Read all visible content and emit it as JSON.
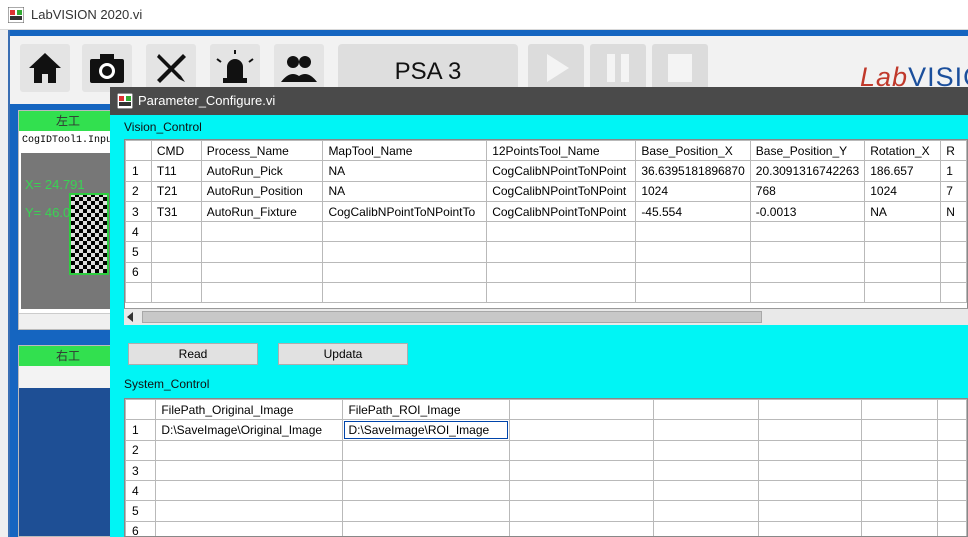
{
  "main_window": {
    "title": "LabVISION 2020.vi",
    "toolbar": {
      "icons": [
        "home-icon",
        "camera-icon",
        "tools-icon",
        "alarm-icon",
        "users-icon"
      ],
      "station_label": "PSA 3",
      "media_icons": [
        "play-icon",
        "pause-icon",
        "stop-icon"
      ],
      "logo_lab": "Lab",
      "logo_vision": "VISION"
    },
    "left_pane_1": {
      "title": "左工",
      "tool_label": "CogIDTool1.Inpu",
      "x_coord": "X= 24.791",
      "y_coord": "Y= 46.0"
    },
    "left_pane_2": {
      "title": "右工"
    }
  },
  "dialog": {
    "title": "Parameter_Configure.vi",
    "vision_control": {
      "label": "Vision_Control",
      "columns": [
        "",
        "CMD",
        "Process_Name",
        "MapTool_Name",
        "12PointsTool_Name",
        "Base_Position_X",
        "Base_Position_Y",
        "Rotation_X",
        "R"
      ],
      "rows": [
        [
          "1",
          "T11",
          "AutoRun_Pick",
          "NA",
          "CogCalibNPointToNPoint",
          "36.6395181896870",
          "20.3091316742263",
          "186.657",
          "1"
        ],
        [
          "2",
          "T21",
          "AutoRun_Position",
          "NA",
          "CogCalibNPointToNPoint",
          "1024",
          "768",
          "1024",
          "7"
        ],
        [
          "3",
          "T31",
          "AutoRun_Fixture",
          "CogCalibNPointToNPointTo",
          "CogCalibNPointToNPoint",
          "-45.554",
          "-0.0013",
          "NA",
          "N"
        ],
        [
          "4",
          "",
          "",
          "",
          "",
          "",
          "",
          "",
          ""
        ],
        [
          "5",
          "",
          "",
          "",
          "",
          "",
          "",
          "",
          ""
        ],
        [
          "6",
          "",
          "",
          "",
          "",
          "",
          "",
          "",
          ""
        ],
        [
          "",
          "",
          "",
          "",
          "",
          "",
          "",
          "",
          ""
        ]
      ]
    },
    "buttons": {
      "read": "Read",
      "updata": "Updata"
    },
    "system_control": {
      "label": "System_Control",
      "columns": [
        "",
        "FilePath_Original_Image",
        "FilePath_ROI_Image",
        "",
        "",
        "",
        "",
        ""
      ],
      "rows": [
        [
          "1",
          "D:\\SaveImage\\Original_Image",
          "D:\\SaveImage\\ROI_Image",
          "",
          "",
          "",
          "",
          ""
        ],
        [
          "2",
          "",
          "",
          "",
          "",
          "",
          "",
          ""
        ],
        [
          "3",
          "",
          "",
          "",
          "",
          "",
          "",
          ""
        ],
        [
          "4",
          "",
          "",
          "",
          "",
          "",
          "",
          ""
        ],
        [
          "5",
          "",
          "",
          "",
          "",
          "",
          "",
          ""
        ],
        [
          "6",
          "",
          "",
          "",
          "",
          "",
          "",
          ""
        ]
      ]
    }
  }
}
